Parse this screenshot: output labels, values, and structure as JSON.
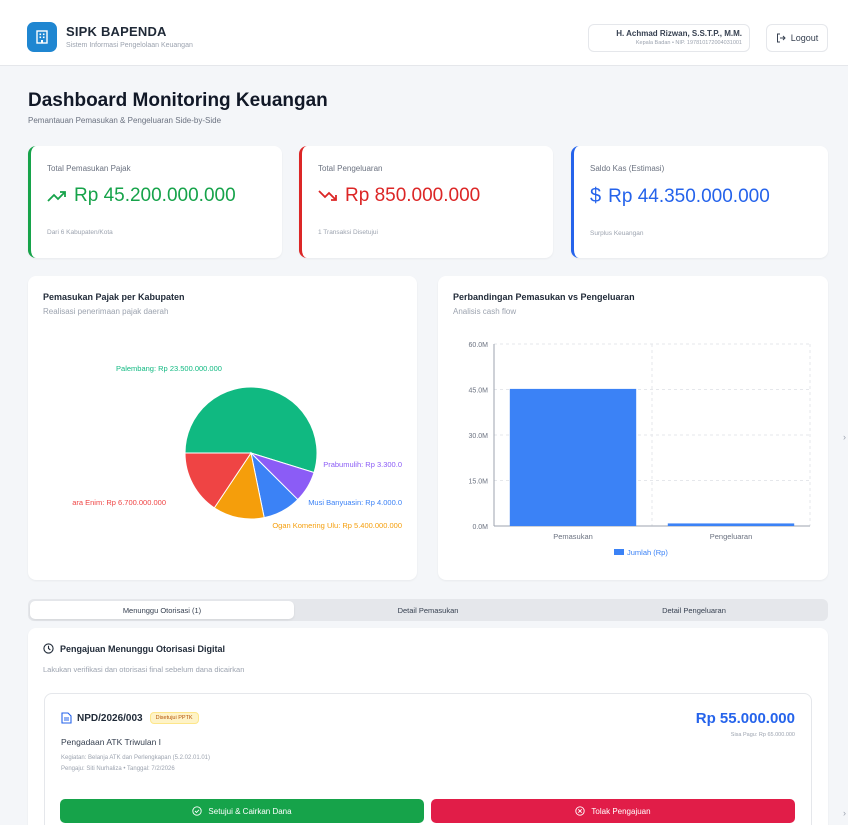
{
  "header": {
    "app_title": "SIPK BAPENDA",
    "app_subtitle": "Sistem Informasi Pengelolaan Keuangan",
    "user_name": "H. Achmad Rizwan, S.S.T.P., M.M.",
    "user_role": "Kepala Badan • NIP. 197810172004031001",
    "logout_label": "Logout"
  },
  "page": {
    "title": "Dashboard Monitoring Keuangan",
    "subtitle": "Pemantauan Pemasukan & Pengeluaran Side-by-Side"
  },
  "stats": [
    {
      "label": "Total Pemasukan Pajak",
      "value": "Rp 45.200.000.000",
      "note": "Dari 6 Kabupaten/Kota",
      "color": "#16a34a",
      "icon": "trending-up-icon"
    },
    {
      "label": "Total Pengeluaran",
      "value": "Rp 850.000.000",
      "note": "1 Transaksi Disetujui",
      "color": "#dc2626",
      "icon": "trending-down-icon"
    },
    {
      "label": "Saldo Kas (Estimasi)",
      "value": "Rp 44.350.000.000",
      "note": "Surplus Keuangan",
      "color": "#2563eb",
      "icon": "dollar-icon"
    }
  ],
  "charts": {
    "pie_title": "Pemasukan Pajak per Kabupaten",
    "pie_subtitle": "Realisasi penerimaan pajak daerah",
    "bar_title": "Perbandingan Pemasukan vs Pengeluaran",
    "bar_subtitle": "Analisis cash flow"
  },
  "chart_data": [
    {
      "type": "pie",
      "labels": [
        "Palembang",
        "Prabumulih",
        "Musi Banyuasin",
        "Ogan Komering Ulu",
        "Muara Enim"
      ],
      "display_labels": [
        "Palembang: Rp 23.500.000.000",
        "Prabumulih: Rp 3.300.0",
        "Musi Banyuasin: Rp 4.000.0",
        "Ogan Komering Ulu: Rp 5.400.000.000",
        "ara Enim: Rp 6.700.000.000"
      ],
      "values": [
        23500000000,
        3300000000,
        4000000000,
        5400000000,
        6700000000
      ],
      "colors": [
        "#10b981",
        "#8b5cf6",
        "#3b82f6",
        "#f59e0b",
        "#ef4444"
      ]
    },
    {
      "type": "bar",
      "categories": [
        "Pemasukan",
        "Pengeluaran"
      ],
      "series": [
        {
          "name": "Jumlah (Rp)",
          "values": [
            45200000000,
            850000000
          ],
          "color": "#3b82f6"
        }
      ],
      "ylim": [
        0,
        60000000000
      ],
      "yticks": [
        "0.0M",
        "15.0M",
        "30.0M",
        "45.0M",
        "60.0M"
      ],
      "legend": "bottom",
      "grid": true
    }
  ],
  "tabs": [
    {
      "label": "Menunggu Otorisasi (1)",
      "active": true
    },
    {
      "label": "Detail Pemasukan",
      "active": false
    },
    {
      "label": "Detail Pengeluaran",
      "active": false
    }
  ],
  "auth": {
    "title": "Pengajuan Menunggu Otorisasi Digital",
    "subtitle": "Lakukan verifikasi dan otorisasi final sebelum dana dicairkan",
    "item": {
      "code": "NPD/2026/003",
      "badge": "Disetujui PPTK",
      "name": "Pengadaan ATK Triwulan I",
      "kegiatan": "Kegiatan: Belanja ATK dan Perlengkapan (5.2.02.01.01)",
      "pengaju": "Pengaju: Siti Nurhaliza • Tanggal: 7/2/2026",
      "amount": "Rp 55.000.000",
      "pagu": "Sisa Pagu: Rp 65.000.000"
    },
    "approve_label": "Setujui & Cairkan Dana",
    "reject_label": "Tolak Pengajuan"
  }
}
